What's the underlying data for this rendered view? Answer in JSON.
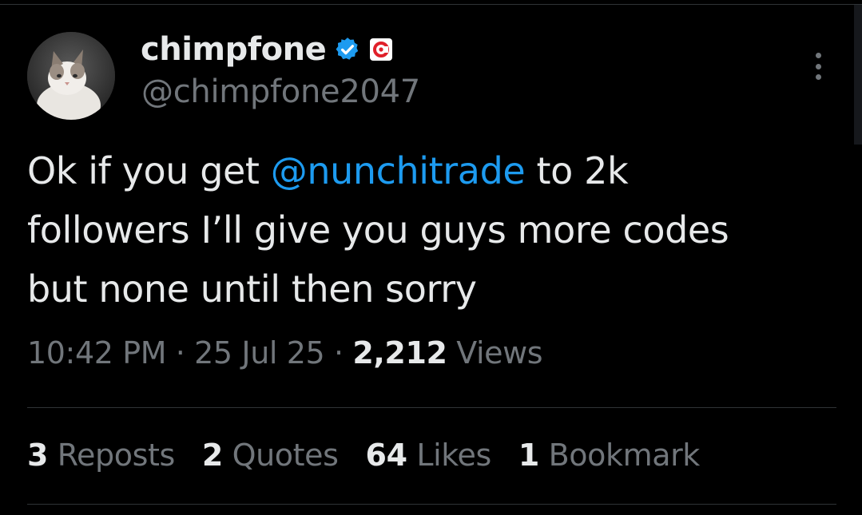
{
  "author": {
    "display_name": "chimpfone",
    "handle": "@chimpfone2047",
    "avatar_icon": "cat-avatar",
    "verified_icon": "verified-check-icon",
    "affiliate_icon": "affiliate-badge-icon"
  },
  "tweet": {
    "text_line1_before": "Ok if you get ",
    "mention": "@nunchitrade",
    "text_line1_after": " to 2k",
    "text_line2": "followers I’ll give you guys more codes",
    "text_line3": "but none until then sorry"
  },
  "meta": {
    "time": "10:42 PM",
    "date": "25 Jul 25",
    "separator": "·",
    "views_count": "2,212",
    "views_label": "Views"
  },
  "stats": {
    "reposts_count": "3",
    "reposts_label": "Reposts",
    "quotes_count": "2",
    "quotes_label": "Quotes",
    "likes_count": "64",
    "likes_label": "Likes",
    "bookmarks_count": "1",
    "bookmarks_label": "Bookmark"
  },
  "colors": {
    "background": "#000000",
    "text_primary": "#e7e9ea",
    "text_secondary": "#71767b",
    "link": "#1d9bf0",
    "divider": "#2f3336"
  }
}
